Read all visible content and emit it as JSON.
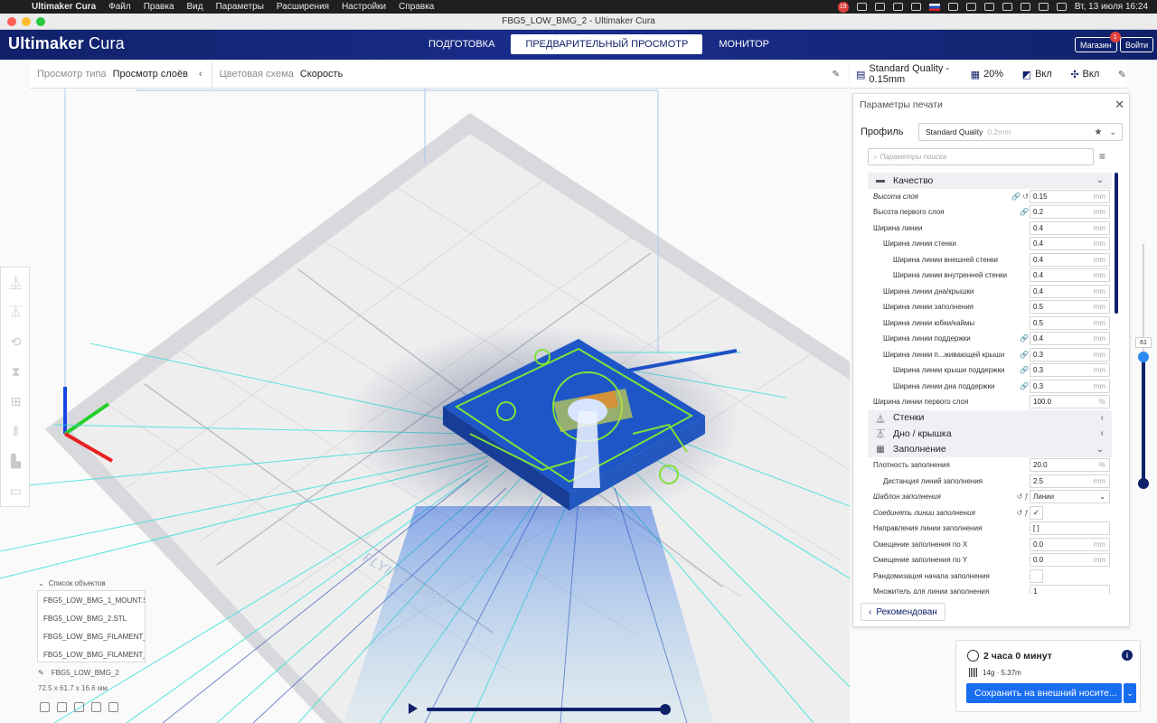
{
  "menubar": {
    "app": "Ultimaker Cura",
    "items": [
      "Файл",
      "Правка",
      "Вид",
      "Параметры",
      "Расширения",
      "Настройки",
      "Справка"
    ],
    "badge": "19",
    "clock": "Вт, 13 июля  16:24"
  },
  "window": {
    "title": "FBG5_LOW_BMG_2 - Ultimaker Cura"
  },
  "header": {
    "logo_bold": "Ultimaker",
    "logo_light": " Cura",
    "stages": [
      "ПОДГОТОВКА",
      "ПРЕДВАРИТЕЛЬНЫЙ ПРОСМОТР",
      "МОНИТОР"
    ],
    "active_stage": "ПРЕДВАРИТЕЛЬНЫЙ ПРОСМОТР",
    "marketplace": "Магазин",
    "marketplace_badge": "1",
    "signin": "Войти",
    "accent": "#10216a"
  },
  "viewbar": {
    "view_type_label": "Просмотр типа",
    "view_type_value": "Просмотр слоёв",
    "color_scheme_label": "Цветовая схема",
    "color_scheme_value": "Скорость"
  },
  "settingsbar": {
    "profile": "Standard Quality - 0.15mm",
    "infill": "20%",
    "support": "Вкл",
    "adhesion": "Вкл"
  },
  "panel": {
    "title": "Параметры печати",
    "profile_label": "Профиль",
    "profile_value": "Standard Quality",
    "profile_sub": "0.2mm",
    "search_placeholder": "Параметры поиска",
    "recommended": "Рекомендован",
    "items": [
      {
        "type": "cat",
        "icon": "quality-icon",
        "label": "Качество",
        "open": true
      },
      {
        "type": "row",
        "label": "Высота слоя",
        "indent": 0,
        "italic": true,
        "icons": "🔗 ↺",
        "value": "0.15",
        "unit": "mm"
      },
      {
        "type": "row",
        "label": "Высота первого слоя",
        "indent": 0,
        "icons": "🔗",
        "value": "0.2",
        "unit": "mm"
      },
      {
        "type": "row",
        "label": "Ширина линии",
        "indent": 0,
        "value": "0.4",
        "unit": "mm"
      },
      {
        "type": "row",
        "label": "Ширина линии стенки",
        "indent": 1,
        "value": "0.4",
        "unit": "mm"
      },
      {
        "type": "row",
        "label": "Ширина линии внешней стенки",
        "indent": 2,
        "value": "0.4",
        "unit": "mm"
      },
      {
        "type": "row",
        "label": "Ширина линии внутренней стенки",
        "indent": 2,
        "value": "0.4",
        "unit": "mm"
      },
      {
        "type": "row",
        "label": "Ширина линии дна/крышки",
        "indent": 1,
        "value": "0.4",
        "unit": "mm"
      },
      {
        "type": "row",
        "label": "Ширина линии заполнения",
        "indent": 1,
        "value": "0.5",
        "unit": "mm"
      },
      {
        "type": "row",
        "label": "Ширина линии юбки/каймы",
        "indent": 1,
        "value": "0.5",
        "unit": "mm"
      },
      {
        "type": "row",
        "label": "Ширина линии поддержки",
        "indent": 1,
        "icons": "🔗",
        "value": "0.4",
        "unit": "mm"
      },
      {
        "type": "row",
        "label": "Ширина линии п...живающей крыши",
        "indent": 1,
        "icons": "🔗",
        "value": "0.3",
        "unit": "mm"
      },
      {
        "type": "row",
        "label": "Ширина линии крыши поддержки",
        "indent": 2,
        "icons": "🔗",
        "value": "0.3",
        "unit": "mm"
      },
      {
        "type": "row",
        "label": "Ширина линии дна поддержки",
        "indent": 2,
        "icons": "🔗",
        "value": "0.3",
        "unit": "mm"
      },
      {
        "type": "row",
        "label": "Ширина линии первого слоя",
        "indent": 0,
        "value": "100.0",
        "unit": "%"
      },
      {
        "type": "cat",
        "icon": "walls-icon",
        "label": "Стенки",
        "open": false
      },
      {
        "type": "cat",
        "icon": "top-bottom-icon",
        "label": "Дно / крышка",
        "open": false
      },
      {
        "type": "cat",
        "icon": "infill-icon",
        "label": "Заполнение",
        "open": true
      },
      {
        "type": "row",
        "label": "Плотность заполнения",
        "indent": 0,
        "value": "20.0",
        "unit": "%"
      },
      {
        "type": "row",
        "label": "Дистанция линий заполнения",
        "indent": 1,
        "value": "2.5",
        "unit": "mm"
      },
      {
        "type": "row",
        "label": "Шаблон заполнения",
        "indent": 0,
        "italic": true,
        "icons": "↺ ƒ",
        "select": "Линии"
      },
      {
        "type": "row",
        "label": "Соединять линии заполнения",
        "indent": 0,
        "italic": true,
        "icons": "↺ ƒ",
        "check": "✓"
      },
      {
        "type": "row",
        "label": "Направления линии заполнения",
        "indent": 0,
        "value": "[ ]",
        "unit": ""
      },
      {
        "type": "row",
        "label": "Смещение заполнения по X",
        "indent": 0,
        "value": "0.0",
        "unit": "mm"
      },
      {
        "type": "row",
        "label": "Смещение заполнения по Y",
        "indent": 0,
        "value": "0.0",
        "unit": "mm"
      },
      {
        "type": "row",
        "label": "Рандомизация начала заполнения",
        "indent": 0,
        "check": ""
      },
      {
        "type": "row",
        "label": "Множитель для линии заполнения",
        "indent": 0,
        "value": "1",
        "unit": ""
      }
    ]
  },
  "estimate": {
    "time": "2 часа 0 минут",
    "material": "14g · 5.37m",
    "save_button": "Сохранить на внешний носите..."
  },
  "objects": {
    "header": "Список объектов",
    "items": [
      "FBG5_LOW_BMG_1_MOUNT.S...",
      "FBG5_LOW_BMG_2.STL",
      "FBG5_LOW_BMG_FILAMENT_...",
      "FBG5_LOW_BMG_FILAMENT_..."
    ],
    "selected": "FBG5_LOW_BMG_2",
    "dimensions": "72.5 x 61.7 x 16.6 мм"
  },
  "layer": {
    "current": "61"
  },
  "toolbar": {
    "tools": [
      "move-tool-icon",
      "scale-tool-icon",
      "rotate-tool-icon",
      "mirror-tool-icon",
      "per-model-settings-icon",
      "support-blocker-icon",
      "tool-icon-7",
      "tool-icon-8"
    ]
  }
}
